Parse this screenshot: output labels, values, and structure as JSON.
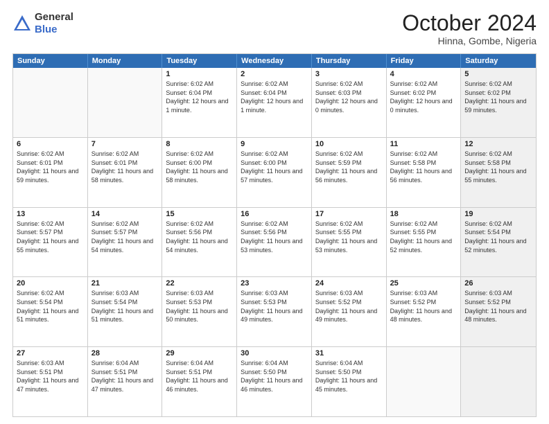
{
  "header": {
    "logo_general": "General",
    "logo_blue": "Blue",
    "month_title": "October 2024",
    "location": "Hinna, Gombe, Nigeria"
  },
  "days_of_week": [
    "Sunday",
    "Monday",
    "Tuesday",
    "Wednesday",
    "Thursday",
    "Friday",
    "Saturday"
  ],
  "weeks": [
    [
      {
        "day": "",
        "empty": true,
        "shaded": false
      },
      {
        "day": "",
        "empty": true,
        "shaded": false
      },
      {
        "day": "1",
        "sunrise": "6:02 AM",
        "sunset": "6:04 PM",
        "daylight": "12 hours and 1 minute."
      },
      {
        "day": "2",
        "sunrise": "6:02 AM",
        "sunset": "6:04 PM",
        "daylight": "12 hours and 1 minute."
      },
      {
        "day": "3",
        "sunrise": "6:02 AM",
        "sunset": "6:03 PM",
        "daylight": "12 hours and 0 minutes."
      },
      {
        "day": "4",
        "sunrise": "6:02 AM",
        "sunset": "6:02 PM",
        "daylight": "12 hours and 0 minutes."
      },
      {
        "day": "5",
        "sunrise": "6:02 AM",
        "sunset": "6:02 PM",
        "daylight": "11 hours and 59 minutes.",
        "shaded": true
      }
    ],
    [
      {
        "day": "6",
        "sunrise": "6:02 AM",
        "sunset": "6:01 PM",
        "daylight": "11 hours and 59 minutes.",
        "shaded": false
      },
      {
        "day": "7",
        "sunrise": "6:02 AM",
        "sunset": "6:01 PM",
        "daylight": "11 hours and 58 minutes."
      },
      {
        "day": "8",
        "sunrise": "6:02 AM",
        "sunset": "6:00 PM",
        "daylight": "11 hours and 58 minutes."
      },
      {
        "day": "9",
        "sunrise": "6:02 AM",
        "sunset": "6:00 PM",
        "daylight": "11 hours and 57 minutes."
      },
      {
        "day": "10",
        "sunrise": "6:02 AM",
        "sunset": "5:59 PM",
        "daylight": "11 hours and 56 minutes."
      },
      {
        "day": "11",
        "sunrise": "6:02 AM",
        "sunset": "5:58 PM",
        "daylight": "11 hours and 56 minutes."
      },
      {
        "day": "12",
        "sunrise": "6:02 AM",
        "sunset": "5:58 PM",
        "daylight": "11 hours and 55 minutes.",
        "shaded": true
      }
    ],
    [
      {
        "day": "13",
        "sunrise": "6:02 AM",
        "sunset": "5:57 PM",
        "daylight": "11 hours and 55 minutes.",
        "shaded": false
      },
      {
        "day": "14",
        "sunrise": "6:02 AM",
        "sunset": "5:57 PM",
        "daylight": "11 hours and 54 minutes."
      },
      {
        "day": "15",
        "sunrise": "6:02 AM",
        "sunset": "5:56 PM",
        "daylight": "11 hours and 54 minutes."
      },
      {
        "day": "16",
        "sunrise": "6:02 AM",
        "sunset": "5:56 PM",
        "daylight": "11 hours and 53 minutes."
      },
      {
        "day": "17",
        "sunrise": "6:02 AM",
        "sunset": "5:55 PM",
        "daylight": "11 hours and 53 minutes."
      },
      {
        "day": "18",
        "sunrise": "6:02 AM",
        "sunset": "5:55 PM",
        "daylight": "11 hours and 52 minutes."
      },
      {
        "day": "19",
        "sunrise": "6:02 AM",
        "sunset": "5:54 PM",
        "daylight": "11 hours and 52 minutes.",
        "shaded": true
      }
    ],
    [
      {
        "day": "20",
        "sunrise": "6:02 AM",
        "sunset": "5:54 PM",
        "daylight": "11 hours and 51 minutes.",
        "shaded": false
      },
      {
        "day": "21",
        "sunrise": "6:03 AM",
        "sunset": "5:54 PM",
        "daylight": "11 hours and 51 minutes."
      },
      {
        "day": "22",
        "sunrise": "6:03 AM",
        "sunset": "5:53 PM",
        "daylight": "11 hours and 50 minutes."
      },
      {
        "day": "23",
        "sunrise": "6:03 AM",
        "sunset": "5:53 PM",
        "daylight": "11 hours and 49 minutes."
      },
      {
        "day": "24",
        "sunrise": "6:03 AM",
        "sunset": "5:52 PM",
        "daylight": "11 hours and 49 minutes."
      },
      {
        "day": "25",
        "sunrise": "6:03 AM",
        "sunset": "5:52 PM",
        "daylight": "11 hours and 48 minutes."
      },
      {
        "day": "26",
        "sunrise": "6:03 AM",
        "sunset": "5:52 PM",
        "daylight": "11 hours and 48 minutes.",
        "shaded": true
      }
    ],
    [
      {
        "day": "27",
        "sunrise": "6:03 AM",
        "sunset": "5:51 PM",
        "daylight": "11 hours and 47 minutes.",
        "shaded": false
      },
      {
        "day": "28",
        "sunrise": "6:04 AM",
        "sunset": "5:51 PM",
        "daylight": "11 hours and 47 minutes."
      },
      {
        "day": "29",
        "sunrise": "6:04 AM",
        "sunset": "5:51 PM",
        "daylight": "11 hours and 46 minutes."
      },
      {
        "day": "30",
        "sunrise": "6:04 AM",
        "sunset": "5:50 PM",
        "daylight": "11 hours and 46 minutes."
      },
      {
        "day": "31",
        "sunrise": "6:04 AM",
        "sunset": "5:50 PM",
        "daylight": "11 hours and 45 minutes."
      },
      {
        "day": "",
        "empty": true
      },
      {
        "day": "",
        "empty": true,
        "shaded": true
      }
    ]
  ]
}
